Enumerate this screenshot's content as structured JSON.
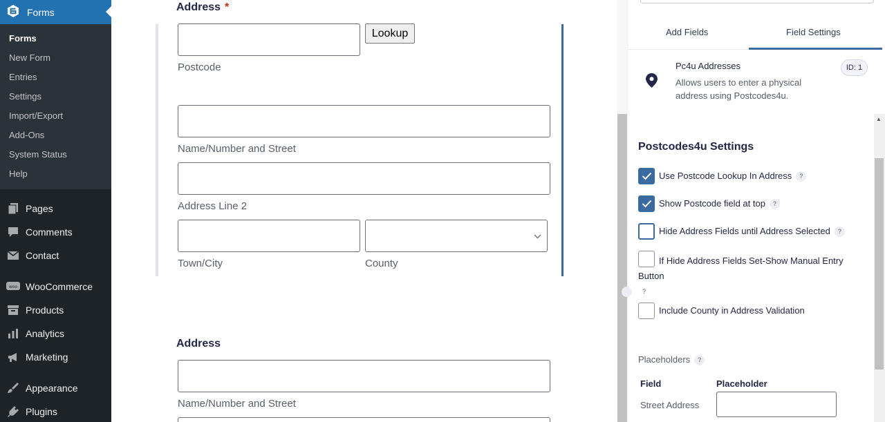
{
  "sidebar": {
    "current": {
      "label": "Forms",
      "icon": "gravity-forms-icon"
    },
    "sub": [
      "Forms",
      "New Form",
      "Entries",
      "Settings",
      "Import/Export",
      "Add-Ons",
      "System Status",
      "Help"
    ],
    "items": [
      {
        "label": "Pages",
        "icon": "pages-icon"
      },
      {
        "label": "Comments",
        "icon": "comments-icon"
      },
      {
        "label": "Contact",
        "icon": "mail-icon"
      },
      {
        "label": "WooCommerce",
        "icon": "woo-icon"
      },
      {
        "label": "Products",
        "icon": "archive-icon"
      },
      {
        "label": "Analytics",
        "icon": "bar-chart-icon"
      },
      {
        "label": "Marketing",
        "icon": "megaphone-icon"
      },
      {
        "label": "Appearance",
        "icon": "brush-icon"
      },
      {
        "label": "Plugins",
        "icon": "plugin-icon"
      }
    ]
  },
  "form": {
    "field1": {
      "label": "Address",
      "required_mark": "*",
      "lookup_button": "Lookup",
      "postcode_label": "Postcode",
      "street_label": "Name/Number and Street",
      "line2_label": "Address Line 2",
      "city_label": "Town/City",
      "county_label": "County"
    },
    "field2": {
      "label": "Address",
      "street_label": "Name/Number and Street"
    }
  },
  "panel": {
    "tabs": [
      "Add Fields",
      "Field Settings"
    ],
    "active_tab": "Field Settings",
    "field_card": {
      "title": "Pc4u Addresses",
      "description": "Allows users to enter a physical address using Postcodes4u.",
      "id_badge": "ID: 1"
    },
    "section_title": "Postcodes4u Settings",
    "help_glyph": "?",
    "options": [
      {
        "label": "Use Postcode Lookup In Address",
        "checked": true
      },
      {
        "label": "Show Postcode field at top",
        "checked": true
      },
      {
        "label": "Hide Address Fields until Address Selected",
        "checked": false
      },
      {
        "label": "If Hide Address Fields Set-Show Manual Entry Button",
        "checked": false
      },
      {
        "label": "Include County in Address Validation",
        "checked": false
      }
    ],
    "placeholders": {
      "title": "Placeholders",
      "col_field": "Field",
      "col_placeholder": "Placeholder",
      "rows": [
        {
          "field": "Street Address",
          "placeholder": ""
        }
      ]
    }
  },
  "colors": {
    "sidebar_bg": "#1d2327",
    "accent": "#2271b1",
    "selected_bar": "#3b6aa0"
  }
}
